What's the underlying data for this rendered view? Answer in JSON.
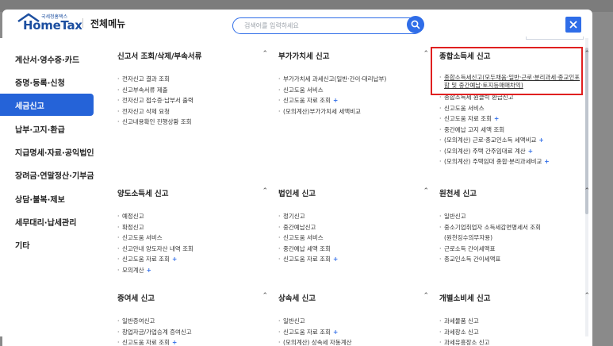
{
  "header": {
    "logo_small": "국세청홈택스",
    "logo_text": "HomeTax",
    "menu_title": "전체메뉴",
    "search_placeholder": "검색어를 입력하세요"
  },
  "icons": {
    "search": "search-icon",
    "close": "close-icon",
    "chevron": "chevron-up-icon",
    "logo_roof": "house-roof-icon"
  },
  "colors": {
    "accent": "#2563d8",
    "highlight": "#e02020",
    "plus": "#2f6de8"
  },
  "sidebar": {
    "items": [
      {
        "label": "계산서·영수증·카드"
      },
      {
        "label": "증명·등록·신청"
      },
      {
        "label": "세금신고"
      },
      {
        "label": "납부·고지·환급"
      },
      {
        "label": "지급명세·자료·공익법인"
      },
      {
        "label": "장려금·연말정산·기부금"
      },
      {
        "label": "상담·불복·제보"
      },
      {
        "label": "세무대리·납세관리"
      },
      {
        "label": "기타"
      }
    ],
    "active_index": 2
  },
  "sections": {
    "s1": {
      "title": "신고서 조회/삭제/부속서류",
      "items": [
        "전자신고 결과 조회",
        "신고부속서류 제출",
        "전자신고 접수증·납부서 출력",
        "전자신고 삭제 요청",
        "신고내용확인 진행상황 조회"
      ]
    },
    "s2": {
      "title": "부가가치세 신고",
      "items": [
        "부가가치세 과세신고(일반·간이·대리납부)",
        "신고도움 서비스",
        "신고도움 자료 조회",
        "(모의계산)부가가치세 세액비교"
      ]
    },
    "s3": {
      "title": "종합소득세 신고",
      "link": "종합소득세신고(모두채움·일반·근로·분리과세·종교인포함 및 중간예납·토지등매매차익)",
      "items": [
        "종합소득세 원클릭 환급신고",
        "신고도움 서비스",
        "신고도움 자료 조회",
        "중간예납 고지 세액 조회",
        "(모의계산) 근로·종교인소득 세액비교",
        "(모의계산) 주택 간주임대료 계산",
        "(모의계산) 주택임대 종합·분리과세비교"
      ]
    },
    "s4": {
      "title": "양도소득세 신고",
      "items": [
        "예정신고",
        "확정신고",
        "신고도움 서비스",
        "신고안내 양도자산 내역 조회",
        "신고도움 자료 조회",
        "모의계산"
      ]
    },
    "s5": {
      "title": "법인세 신고",
      "items": [
        "정기신고",
        "중간예납신고",
        "신고도움 서비스",
        "중간예납 세액 조회",
        "신고도움 자료 조회"
      ]
    },
    "s6": {
      "title": "원천세 신고",
      "items": [
        "일반신고",
        "중소기업취업자 소득세감면명세서 조회",
        "(원천징수의무자용)",
        "근로소득 간이세액표",
        "종교인소득 간이세액표"
      ]
    },
    "s7": {
      "title": "증여세 신고",
      "items": [
        "일반증여신고",
        "창업자금/가업승계 증여신고",
        "신고도움 자료 조회"
      ]
    },
    "s8": {
      "title": "상속세 신고",
      "items": [
        "일반신고",
        "신고도움 자료 조회",
        "(모의계산) 상속세 자동계산"
      ]
    },
    "s9": {
      "title": "개별소비세 신고",
      "items": [
        "과세물품 신고",
        "과세장소 신고",
        "과세유흥장소 신고"
      ]
    }
  }
}
